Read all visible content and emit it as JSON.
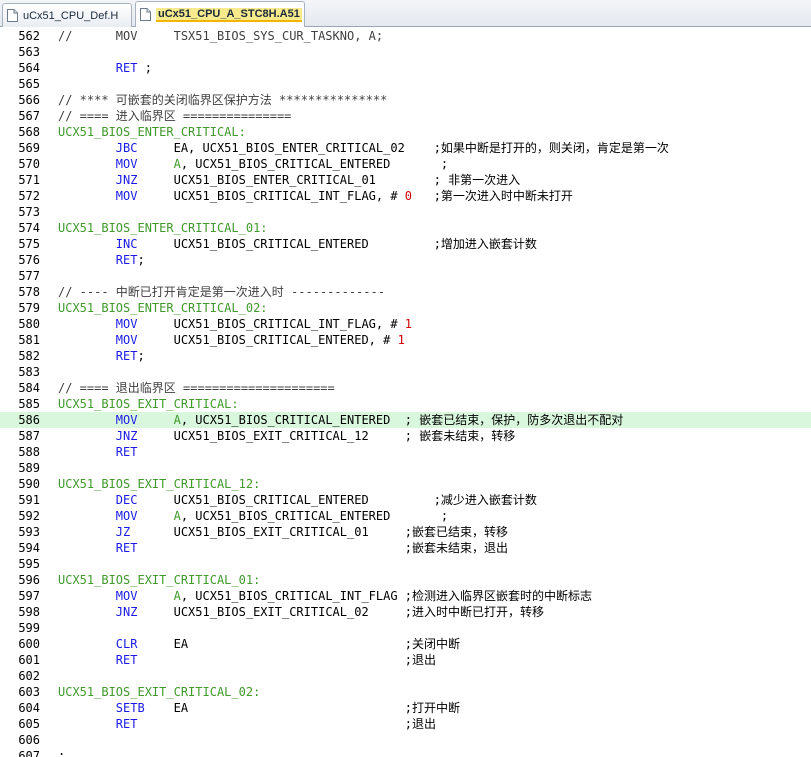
{
  "tabs": [
    {
      "label": "uCx51_CPU_Def.H",
      "active": false
    },
    {
      "label": "uCx51_CPU_A_STC8H.A51",
      "active": true
    }
  ],
  "editor": {
    "highlight_line": 586,
    "lines": [
      {
        "no": "562",
        "segs": [
          [
            "cmt",
            "//      MOV     TSX51_BIOS_SYS_CUR_TASKNO, A;"
          ]
        ]
      },
      {
        "no": "563",
        "segs": []
      },
      {
        "no": "564",
        "segs": [
          [
            "t",
            "        "
          ],
          [
            "kw",
            "RET"
          ],
          [
            "t",
            " ;"
          ]
        ]
      },
      {
        "no": "565",
        "segs": []
      },
      {
        "no": "566",
        "segs": [
          [
            "cmt",
            "// **** 可嵌套的关闭临界区保护方法 ***************"
          ]
        ]
      },
      {
        "no": "567",
        "segs": [
          [
            "cmt",
            "// ==== 进入临界区 ==============="
          ]
        ]
      },
      {
        "no": "568",
        "segs": [
          [
            "label",
            "UCX51_BIOS_ENTER_CRITICAL:"
          ]
        ]
      },
      {
        "no": "569",
        "segs": [
          [
            "t",
            "        "
          ],
          [
            "kw",
            "JBC"
          ],
          [
            "t",
            "     EA, UCX51_BIOS_ENTER_CRITICAL_02    ;如果中断是打开的，则关闭，肯定是第一次"
          ]
        ]
      },
      {
        "no": "570",
        "segs": [
          [
            "t",
            "        "
          ],
          [
            "kw",
            "MOV"
          ],
          [
            "t",
            "     "
          ],
          [
            "label",
            "A"
          ],
          [
            "t",
            ", UCX51_BIOS_CRITICAL_ENTERED       ;"
          ]
        ]
      },
      {
        "no": "571",
        "segs": [
          [
            "t",
            "        "
          ],
          [
            "kw",
            "JNZ"
          ],
          [
            "t",
            "     UCX51_BIOS_ENTER_CRITICAL_01        ; 非第一次进入"
          ]
        ]
      },
      {
        "no": "572",
        "segs": [
          [
            "t",
            "        "
          ],
          [
            "kw",
            "MOV"
          ],
          [
            "t",
            "     UCX51_BIOS_CRITICAL_INT_FLAG, # "
          ],
          [
            "num",
            "0"
          ],
          [
            "t",
            "   ;第一次进入时中断未打开"
          ]
        ]
      },
      {
        "no": "573",
        "segs": []
      },
      {
        "no": "574",
        "segs": [
          [
            "label",
            "UCX51_BIOS_ENTER_CRITICAL_01:"
          ]
        ]
      },
      {
        "no": "575",
        "segs": [
          [
            "t",
            "        "
          ],
          [
            "kw",
            "INC"
          ],
          [
            "t",
            "     UCX51_BIOS_CRITICAL_ENTERED         ;增加进入嵌套计数"
          ]
        ]
      },
      {
        "no": "576",
        "segs": [
          [
            "t",
            "        "
          ],
          [
            "kw",
            "RET"
          ],
          [
            "t",
            ";"
          ]
        ]
      },
      {
        "no": "577",
        "segs": []
      },
      {
        "no": "578",
        "segs": [
          [
            "cmt",
            "// ---- 中断已打开肯定是第一次进入时 -------------"
          ]
        ]
      },
      {
        "no": "579",
        "segs": [
          [
            "label",
            "UCX51_BIOS_ENTER_CRITICAL_02:"
          ]
        ]
      },
      {
        "no": "580",
        "segs": [
          [
            "t",
            "        "
          ],
          [
            "kw",
            "MOV"
          ],
          [
            "t",
            "     UCX51_BIOS_CRITICAL_INT_FLAG, # "
          ],
          [
            "num",
            "1"
          ]
        ]
      },
      {
        "no": "581",
        "segs": [
          [
            "t",
            "        "
          ],
          [
            "kw",
            "MOV"
          ],
          [
            "t",
            "     UCX51_BIOS_CRITICAL_ENTERED, # "
          ],
          [
            "num",
            "1"
          ]
        ]
      },
      {
        "no": "582",
        "segs": [
          [
            "t",
            "        "
          ],
          [
            "kw",
            "RET"
          ],
          [
            "t",
            ";"
          ]
        ]
      },
      {
        "no": "583",
        "segs": []
      },
      {
        "no": "584",
        "segs": [
          [
            "cmt",
            "// ==== 退出临界区 ====================="
          ]
        ]
      },
      {
        "no": "585",
        "segs": [
          [
            "label",
            "UCX51_BIOS_EXIT_CRITICAL:"
          ]
        ]
      },
      {
        "no": "586",
        "segs": [
          [
            "t",
            "        "
          ],
          [
            "kw",
            "MOV"
          ],
          [
            "t",
            "     "
          ],
          [
            "label",
            "A"
          ],
          [
            "t",
            ", UCX51_BIOS_CRITICAL_ENTERED  ; 嵌套已结束，保护，防多次退出不配对"
          ]
        ]
      },
      {
        "no": "587",
        "segs": [
          [
            "t",
            "        "
          ],
          [
            "kw",
            "JNZ"
          ],
          [
            "t",
            "     UCX51_BIOS_EXIT_CRITICAL_12     ; 嵌套未结束，转移"
          ]
        ]
      },
      {
        "no": "588",
        "segs": [
          [
            "t",
            "        "
          ],
          [
            "kw",
            "RET"
          ]
        ]
      },
      {
        "no": "589",
        "segs": []
      },
      {
        "no": "590",
        "segs": [
          [
            "label",
            "UCX51_BIOS_EXIT_CRITICAL_12:"
          ]
        ]
      },
      {
        "no": "591",
        "segs": [
          [
            "t",
            "        "
          ],
          [
            "kw",
            "DEC"
          ],
          [
            "t",
            "     UCX51_BIOS_CRITICAL_ENTERED         ;减少进入嵌套计数"
          ]
        ]
      },
      {
        "no": "592",
        "segs": [
          [
            "t",
            "        "
          ],
          [
            "kw",
            "MOV"
          ],
          [
            "t",
            "     "
          ],
          [
            "label",
            "A"
          ],
          [
            "t",
            ", UCX51_BIOS_CRITICAL_ENTERED       ;"
          ]
        ]
      },
      {
        "no": "593",
        "segs": [
          [
            "t",
            "        "
          ],
          [
            "kw",
            "JZ"
          ],
          [
            "t",
            "      UCX51_BIOS_EXIT_CRITICAL_01     ;嵌套已结束，转移"
          ]
        ]
      },
      {
        "no": "594",
        "segs": [
          [
            "t",
            "        "
          ],
          [
            "kw",
            "RET"
          ],
          [
            "t",
            "                                     ;嵌套未结束，退出"
          ]
        ]
      },
      {
        "no": "595",
        "segs": []
      },
      {
        "no": "596",
        "segs": [
          [
            "label",
            "UCX51_BIOS_EXIT_CRITICAL_01:"
          ]
        ]
      },
      {
        "no": "597",
        "segs": [
          [
            "t",
            "        "
          ],
          [
            "kw",
            "MOV"
          ],
          [
            "t",
            "     "
          ],
          [
            "label",
            "A"
          ],
          [
            "t",
            ", UCX51_BIOS_CRITICAL_INT_FLAG ;检测进入临界区嵌套时的中断标志"
          ]
        ]
      },
      {
        "no": "598",
        "segs": [
          [
            "t",
            "        "
          ],
          [
            "kw",
            "JNZ"
          ],
          [
            "t",
            "     UCX51_BIOS_EXIT_CRITICAL_02     ;进入时中断已打开，转移"
          ]
        ]
      },
      {
        "no": "599",
        "segs": []
      },
      {
        "no": "600",
        "segs": [
          [
            "t",
            "        "
          ],
          [
            "kw",
            "CLR"
          ],
          [
            "t",
            "     EA                              ;关闭中断"
          ]
        ]
      },
      {
        "no": "601",
        "segs": [
          [
            "t",
            "        "
          ],
          [
            "kw",
            "RET"
          ],
          [
            "t",
            "                                     ;退出"
          ]
        ]
      },
      {
        "no": "602",
        "segs": []
      },
      {
        "no": "603",
        "segs": [
          [
            "label",
            "UCX51_BIOS_EXIT_CRITICAL_02:"
          ]
        ]
      },
      {
        "no": "604",
        "segs": [
          [
            "t",
            "        "
          ],
          [
            "kw",
            "SETB"
          ],
          [
            "t",
            "    EA                              ;打开中断"
          ]
        ]
      },
      {
        "no": "605",
        "segs": [
          [
            "t",
            "        "
          ],
          [
            "kw",
            "RET"
          ],
          [
            "t",
            "                                     ;退出"
          ]
        ]
      },
      {
        "no": "606",
        "segs": []
      },
      {
        "no": "607",
        "segs": [
          [
            "t",
            ";"
          ]
        ]
      }
    ]
  }
}
